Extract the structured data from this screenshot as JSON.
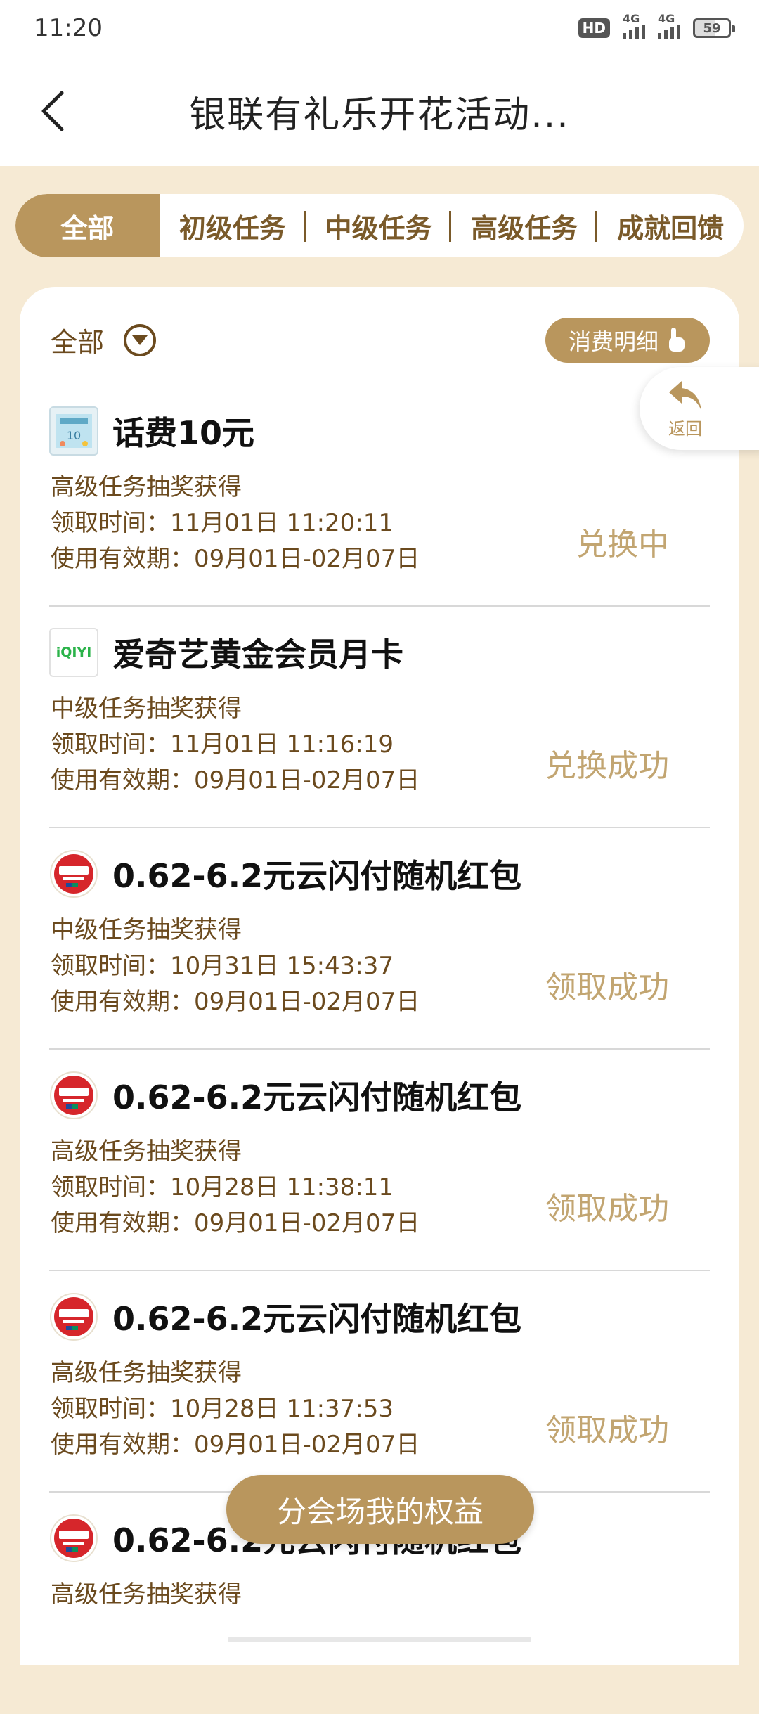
{
  "status_bar": {
    "time": "11:20",
    "hd_label": "HD",
    "network_1": "4G",
    "network_2": "4G",
    "battery": "59"
  },
  "nav": {
    "title": "银联有礼乐开花活动...",
    "back_icon": "chevron-left-icon"
  },
  "tabs": [
    {
      "label": "全部",
      "active": true
    },
    {
      "label": "初级任务",
      "active": false
    },
    {
      "label": "中级任务",
      "active": false
    },
    {
      "label": "高级任务",
      "active": false
    },
    {
      "label": "成就回馈",
      "active": false
    }
  ],
  "filter": {
    "label": "全部",
    "icon": "dropdown-circle-icon"
  },
  "detail_button": {
    "label": "消费明细",
    "icon": "hand-pointer-icon"
  },
  "return_float": {
    "label": "返回",
    "icon": "return-arrow-icon"
  },
  "items": [
    {
      "name": "话费10元",
      "icon": "phone-credit-icon",
      "source": "高级任务抽奖获得",
      "claim_time": "领取时间：11月01日 11:20:11",
      "valid_period": "使用有效期：09月01日-02月07日",
      "status": "兑换中"
    },
    {
      "name": "爱奇艺黄金会员月卡",
      "icon": "iqiyi-icon",
      "icon_text": "iQIYI",
      "source": "中级任务抽奖获得",
      "claim_time": "领取时间：11月01日 11:16:19",
      "valid_period": "使用有效期：09月01日-02月07日",
      "status": "兑换成功"
    },
    {
      "name": "0.62-6.2元云闪付随机红包",
      "icon": "unionpay-icon",
      "source": "中级任务抽奖获得",
      "claim_time": "领取时间：10月31日 15:43:37",
      "valid_period": "使用有效期：09月01日-02月07日",
      "status": "领取成功"
    },
    {
      "name": "0.62-6.2元云闪付随机红包",
      "icon": "unionpay-icon",
      "source": "高级任务抽奖获得",
      "claim_time": "领取时间：10月28日 11:38:11",
      "valid_period": "使用有效期：09月01日-02月07日",
      "status": "领取成功"
    },
    {
      "name": "0.62-6.2元云闪付随机红包",
      "icon": "unionpay-icon",
      "source": "高级任务抽奖获得",
      "claim_time": "领取时间：10月28日 11:37:53",
      "valid_period": "使用有效期：09月01日-02月07日",
      "status": "领取成功"
    },
    {
      "name": "0.62-6.2元云闪付随机红包",
      "icon": "unionpay-icon",
      "source": "高级任务抽奖获得",
      "claim_time": "",
      "valid_period": "",
      "status": ""
    }
  ],
  "floating_button": {
    "label": "分会场我的权益"
  },
  "colors": {
    "accent": "#b9965d",
    "accent_text": "#6b4a1e",
    "status_text": "#c2a571",
    "page_bg": "#f6ead4"
  }
}
